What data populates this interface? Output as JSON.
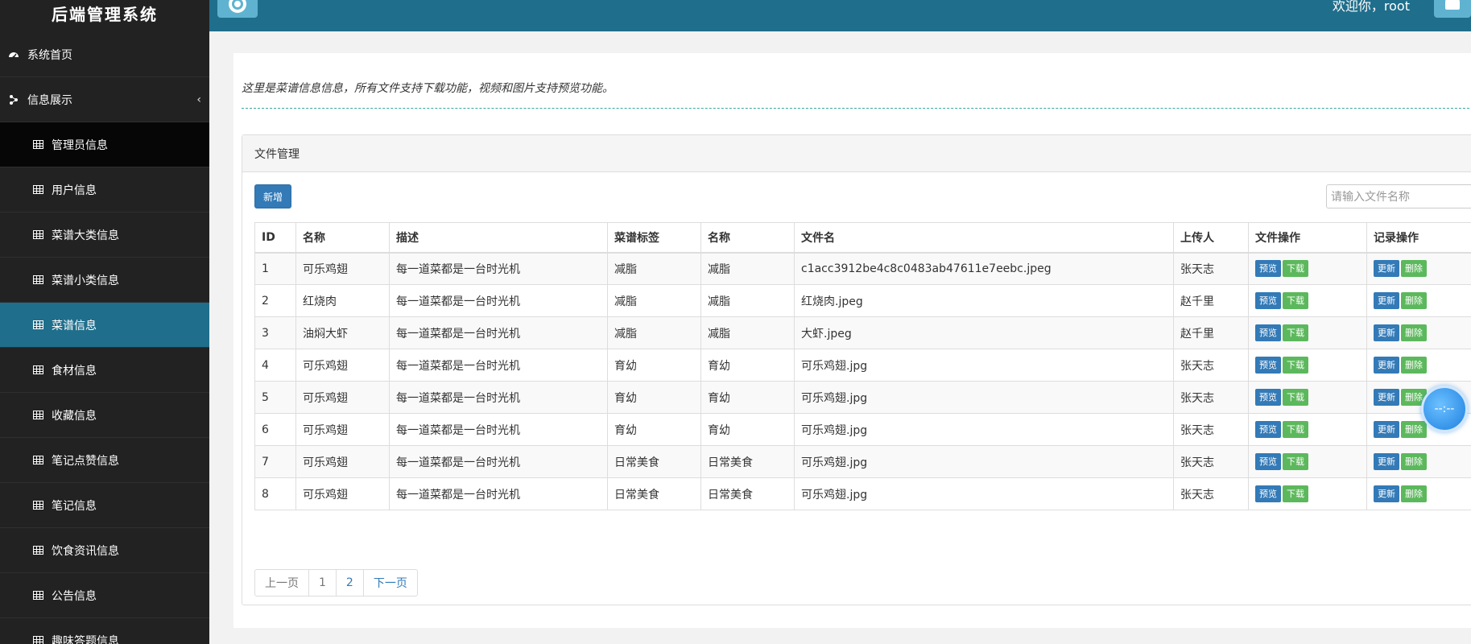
{
  "app": {
    "title": "后端管理系统"
  },
  "header": {
    "welcome": "欢迎你，root"
  },
  "sidebar": {
    "items": [
      {
        "label": "系统首页"
      },
      {
        "label": "信息展示"
      },
      {
        "label": "管理员信息"
      },
      {
        "label": "用户信息"
      },
      {
        "label": "菜谱大类信息"
      },
      {
        "label": "菜谱小类信息"
      },
      {
        "label": "菜谱信息"
      },
      {
        "label": "食材信息"
      },
      {
        "label": "收藏信息"
      },
      {
        "label": "笔记点赞信息"
      },
      {
        "label": "笔记信息"
      },
      {
        "label": "饮食资讯信息"
      },
      {
        "label": "公告信息"
      },
      {
        "label": "趣味答题信息"
      }
    ]
  },
  "intro": "这里是菜谱信息信息，所有文件支持下载功能，视频和图片支持预览功能。",
  "card": {
    "title": "文件管理",
    "add_label": "新增",
    "search_placeholder": "请输入文件名称"
  },
  "table": {
    "headers": [
      "ID",
      "名称",
      "描述",
      "菜谱标签",
      "名称",
      "文件名",
      "上传人",
      "文件操作",
      "记录操作"
    ],
    "actions": {
      "preview": "预览",
      "download": "下载",
      "update": "更新",
      "delete": "删除"
    },
    "rows": [
      {
        "id": "1",
        "name": "可乐鸡翅",
        "desc": "每一道菜都是一台时光机",
        "tag": "减脂",
        "name2": "减脂",
        "file": "c1acc3912be4c8c0483ab47611e7eebc.jpeg",
        "uploader": "张天志"
      },
      {
        "id": "2",
        "name": "红烧肉",
        "desc": "每一道菜都是一台时光机",
        "tag": "减脂",
        "name2": "减脂",
        "file": "红烧肉.jpeg",
        "uploader": "赵千里"
      },
      {
        "id": "3",
        "name": "油焖大虾",
        "desc": "每一道菜都是一台时光机",
        "tag": "减脂",
        "name2": "减脂",
        "file": "大虾.jpeg",
        "uploader": "赵千里"
      },
      {
        "id": "4",
        "name": "可乐鸡翅",
        "desc": "每一道菜都是一台时光机",
        "tag": "育幼",
        "name2": "育幼",
        "file": "可乐鸡翅.jpg",
        "uploader": "张天志"
      },
      {
        "id": "5",
        "name": "可乐鸡翅",
        "desc": "每一道菜都是一台时光机",
        "tag": "育幼",
        "name2": "育幼",
        "file": "可乐鸡翅.jpg",
        "uploader": "张天志"
      },
      {
        "id": "6",
        "name": "可乐鸡翅",
        "desc": "每一道菜都是一台时光机",
        "tag": "育幼",
        "name2": "育幼",
        "file": "可乐鸡翅.jpg",
        "uploader": "张天志"
      },
      {
        "id": "7",
        "name": "可乐鸡翅",
        "desc": "每一道菜都是一台时光机",
        "tag": "日常美食",
        "name2": "日常美食",
        "file": "可乐鸡翅.jpg",
        "uploader": "张天志"
      },
      {
        "id": "8",
        "name": "可乐鸡翅",
        "desc": "每一道菜都是一台时光机",
        "tag": "日常美食",
        "name2": "日常美食",
        "file": "可乐鸡翅.jpg",
        "uploader": "张天志"
      }
    ]
  },
  "pagination": {
    "prev": "上一页",
    "pages": [
      "1",
      "2"
    ],
    "next": "下一页"
  },
  "float_ball": {
    "text": "--:--"
  }
}
